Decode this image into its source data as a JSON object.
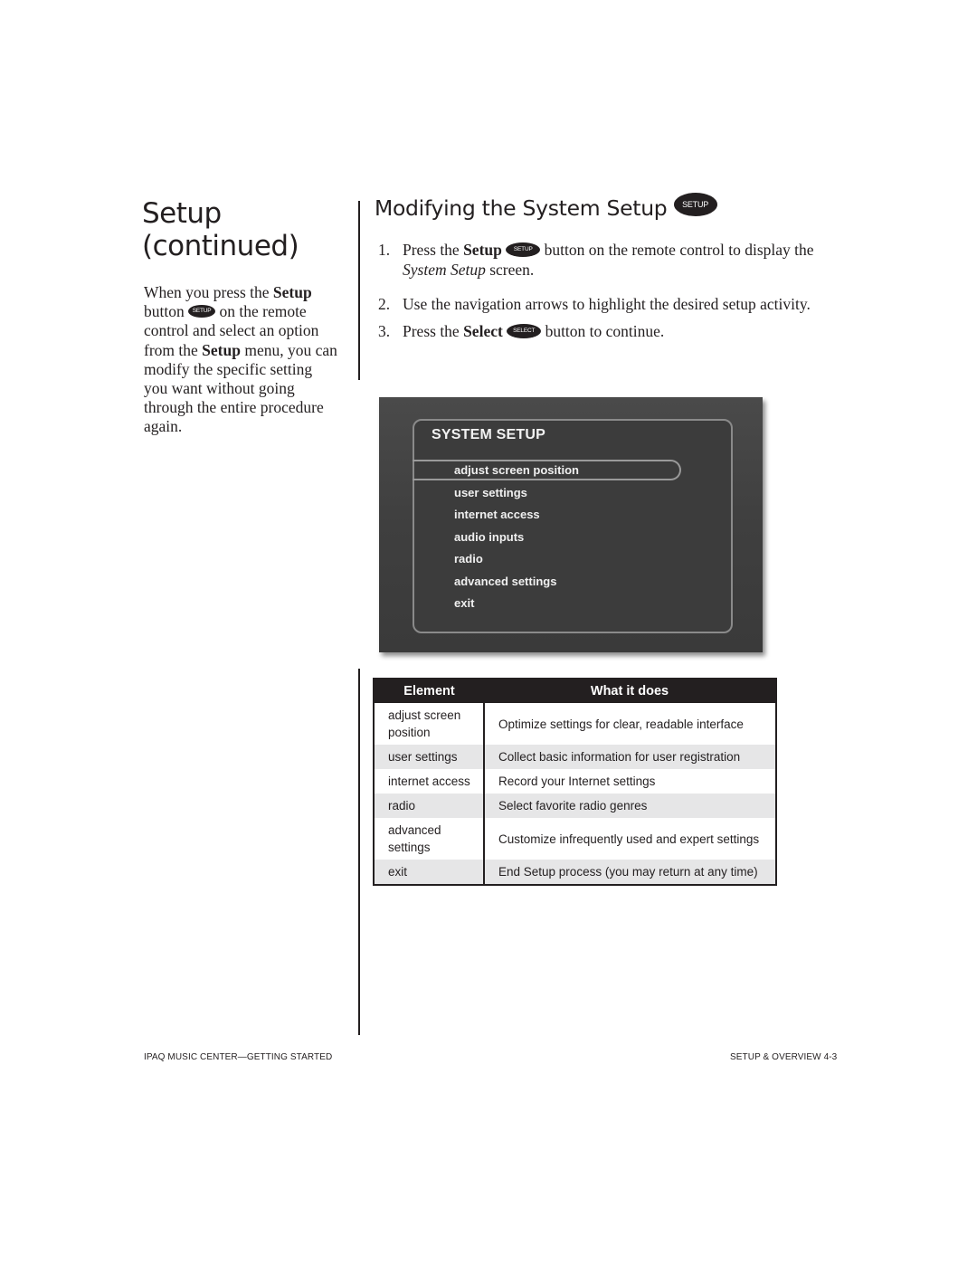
{
  "left": {
    "title_line1": "Setup",
    "title_line2": "(continued)",
    "body": {
      "t1": "When you press the ",
      "b1": "Setup",
      "t2": " button ",
      "icon1": "SETUP",
      "t3": " on the remote control and select an option from the ",
      "b2": "Setup",
      "t4": " menu, you can modify the specific setting you want without going through the entire procedure again."
    }
  },
  "right": {
    "title": "Modifying the System Setup",
    "title_icon": "SETUP",
    "steps": [
      {
        "num": "1.",
        "t1": " Press the ",
        "b": "Setup",
        "icon": "SETUP",
        "t2": " button on the remote control to display the ",
        "i": "System Setup",
        "t3": " screen."
      },
      {
        "num": "2.",
        "t1": "Use the navigation arrows to highlight the desired setup activity."
      },
      {
        "num": "3.",
        "t1": "Press the ",
        "b": "Select",
        "icon": "SELECT",
        "t2": " button to continue."
      }
    ]
  },
  "screen": {
    "title": "SYSTEM SETUP",
    "selected_index": 0,
    "items": [
      "adjust screen position",
      "user settings",
      "internet access",
      "audio inputs",
      "radio",
      "advanced settings",
      "exit"
    ]
  },
  "table": {
    "headers": [
      "Element",
      "What it does"
    ],
    "rows": [
      [
        "adjust screen position",
        "Optimize settings for clear, readable interface"
      ],
      [
        "user settings",
        "Collect basic information for user registration"
      ],
      [
        "internet access",
        "Record your Internet settings"
      ],
      [
        "radio",
        "Select favorite radio genres"
      ],
      [
        "advanced settings",
        "Customize infrequently used and expert settings"
      ],
      [
        "exit",
        "End Setup process (you may return at any time)"
      ]
    ]
  },
  "footer": {
    "left": "iPAQ Music Center—Getting Started",
    "right": "Setup & Overview 4-3"
  }
}
